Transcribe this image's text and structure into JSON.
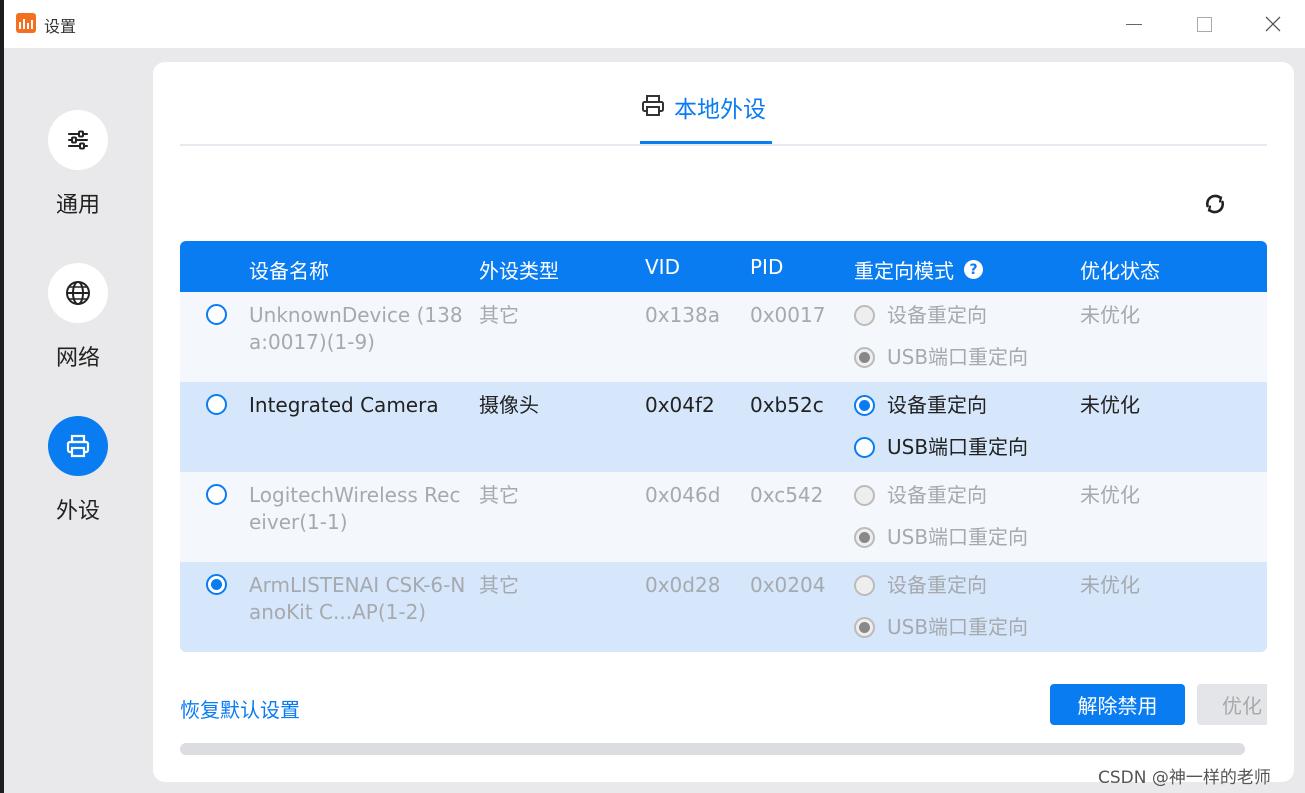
{
  "window": {
    "title": "设置"
  },
  "sidebar": {
    "items": [
      {
        "label": "通用",
        "icon": "sliders-icon"
      },
      {
        "label": "网络",
        "icon": "globe-icon"
      },
      {
        "label": "外设",
        "icon": "printer-icon",
        "active": true
      }
    ]
  },
  "tab": {
    "label": "本地外设"
  },
  "table": {
    "headers": {
      "name": "设备名称",
      "type": "外设类型",
      "vid": "VID",
      "pid": "PID",
      "mode": "重定向模式",
      "help": "?",
      "opt": "优化状态"
    },
    "rows": [
      {
        "name": "UnknownDevice (138a:0017)(1-9)",
        "type": "其它",
        "vid": "0x138a",
        "pid": "0x0017",
        "mode1": "设备重定向",
        "mode2": "USB端口重定向",
        "opt": "未优化"
      },
      {
        "name": "Integrated Camera",
        "type": "摄像头",
        "vid": "0x04f2",
        "pid": "0xb52c",
        "mode1": "设备重定向",
        "mode2": "USB端口重定向",
        "opt": "未优化"
      },
      {
        "name": "LogitechWireless Receiver(1-1)",
        "type": "其它",
        "vid": "0x046d",
        "pid": "0xc542",
        "mode1": "设备重定向",
        "mode2": "USB端口重定向",
        "opt": "未优化"
      },
      {
        "name": "ArmLISTENAI CSK-6-NanoKit C...AP(1-2)",
        "type": "其它",
        "vid": "0x0d28",
        "pid": "0x0204",
        "mode1": "设备重定向",
        "mode2": "USB端口重定向",
        "opt": "未优化"
      }
    ]
  },
  "footer": {
    "restore": "恢复默认设置",
    "unban": "解除禁用",
    "optimize": "优化"
  },
  "watermark": "CSDN @神一样的老师",
  "colors": {
    "accent": "#0a7cf2",
    "row_alt": "#d6e7fc",
    "brand_icon": "#f37021"
  }
}
